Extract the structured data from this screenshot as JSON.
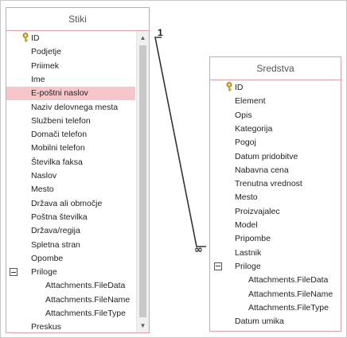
{
  "stiki": {
    "title": "Stiki",
    "fields": [
      {
        "label": "ID",
        "key": true
      },
      {
        "label": "Podjetje"
      },
      {
        "label": "Priimek"
      },
      {
        "label": "Ime"
      },
      {
        "label": "E-poštni naslov",
        "selected": true
      },
      {
        "label": "Naziv delovnega mesta"
      },
      {
        "label": "Službeni telefon"
      },
      {
        "label": "Domači telefon"
      },
      {
        "label": "Mobilni telefon"
      },
      {
        "label": "Številka faksa"
      },
      {
        "label": "Naslov"
      },
      {
        "label": "Mesto"
      },
      {
        "label": "Država ali območje"
      },
      {
        "label": "Poštna številka"
      },
      {
        "label": "Država/regija"
      },
      {
        "label": "Spletna stran"
      },
      {
        "label": "Opombe"
      },
      {
        "label": "Priloge",
        "expander": "minus-box-icon"
      },
      {
        "label": "Attachments.FileData",
        "child": true
      },
      {
        "label": "Attachments.FileName",
        "child": true
      },
      {
        "label": "Attachments.FileType",
        "child": true
      },
      {
        "label": "Preskus"
      }
    ]
  },
  "sredstva": {
    "title": "Sredstva",
    "fields": [
      {
        "label": "ID",
        "key": true
      },
      {
        "label": "Element"
      },
      {
        "label": "Opis"
      },
      {
        "label": "Kategorija"
      },
      {
        "label": "Pogoj"
      },
      {
        "label": "Datum pridobitve"
      },
      {
        "label": "Nabavna cena"
      },
      {
        "label": "Trenutna vrednost"
      },
      {
        "label": "Mesto"
      },
      {
        "label": "Proizvajalec"
      },
      {
        "label": "Model"
      },
      {
        "label": "Pripombe"
      },
      {
        "label": "Lastnik"
      },
      {
        "label": "Priloge",
        "expander": "minus-box-icon"
      },
      {
        "label": "Attachments.FileData",
        "child": true
      },
      {
        "label": "Attachments.FileName",
        "child": true
      },
      {
        "label": "Attachments.FileType",
        "child": true
      },
      {
        "label": "Datum umika"
      }
    ]
  },
  "relationship": {
    "one_label": "1",
    "many_label": "∞"
  },
  "icons": {
    "key": "key-icon",
    "scroll_up": "scroll-up-arrow-icon",
    "scroll_down": "scroll-down-arrow-icon"
  },
  "colors": {
    "table_border": "#d9a1aa",
    "selected_row": "#f6c6cb",
    "key_gold": "#c9a227"
  }
}
